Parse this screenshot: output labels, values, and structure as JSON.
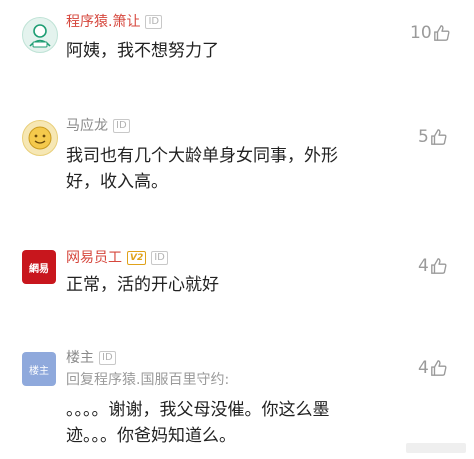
{
  "comments": [
    {
      "author": "程序猿.箫让",
      "id_badge": "ID",
      "likes": "10",
      "lines": [
        "阿姨，我不想努力了"
      ]
    },
    {
      "author": "马应龙",
      "id_badge": "ID",
      "likes": "5",
      "lines": [
        "我司也有几个大龄单身女同事，外形",
        "好，收入高。"
      ]
    },
    {
      "author": "网易员工",
      "id_badge": "ID",
      "vip_badge": "V2",
      "avatar_text": "網易",
      "likes": "4",
      "lines": [
        "正常，活的开心就好"
      ]
    },
    {
      "author": "楼主",
      "id_badge": "ID",
      "avatar_text": "楼主",
      "likes": "4",
      "reply_to": "回复程序猿.国服百里守约:",
      "lines": [
        "。。。。谢谢，我父母没催。你这么墨",
        "迹。。。你爸妈知道么。"
      ]
    }
  ],
  "colors": {
    "author_red": "#d6473d",
    "author_gray": "#8a8a8a",
    "body_text": "#222222",
    "meta_gray": "#9a9a9a",
    "netease_red": "#c8161d",
    "owner_blue": "#8fa9dc"
  },
  "icons": {
    "likes": "thumbs-up-icon"
  }
}
